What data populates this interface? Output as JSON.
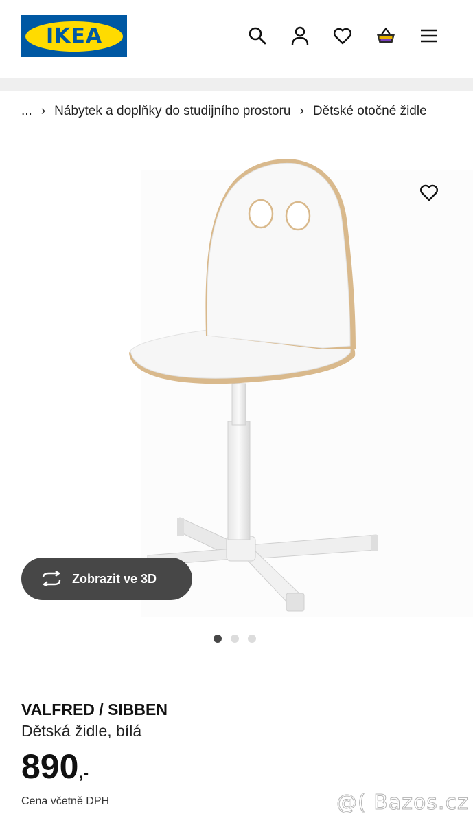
{
  "header": {
    "logo_text": "IKEA",
    "icons": [
      "search-icon",
      "account-icon",
      "heart-icon",
      "basket-icon",
      "menu-icon"
    ]
  },
  "breadcrumb": {
    "items": [
      "...",
      "Nábytek a doplňky do studijního prostoru",
      "Dětské otočné židle"
    ],
    "separator": "›"
  },
  "gallery": {
    "view_3d_label": "Zobrazit ve 3D",
    "dot_count": 3,
    "active_dot": 1
  },
  "product": {
    "name": "VALFRED / SIBBEN",
    "description": "Dětská židle, bílá",
    "price": "890",
    "price_suffix": ",-",
    "price_note": "Cena včetně DPH"
  },
  "watermark": "@( Bazos.cz",
  "colors": {
    "ikea_blue": "#0058a3",
    "ikea_yellow": "#ffdb00",
    "button_dark": "#474747",
    "basket_accent": "#e8b400"
  }
}
